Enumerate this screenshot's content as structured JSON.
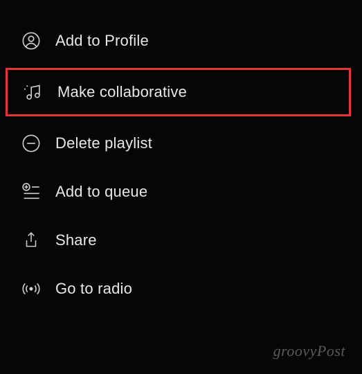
{
  "menu": {
    "items": [
      {
        "label": "Add to Profile",
        "icon": "profile-icon",
        "highlighted": false
      },
      {
        "label": "Make collaborative",
        "icon": "music-note-icon",
        "highlighted": true
      },
      {
        "label": "Delete playlist",
        "icon": "minus-circle-icon",
        "highlighted": false
      },
      {
        "label": "Add to queue",
        "icon": "add-queue-icon",
        "highlighted": false
      },
      {
        "label": "Share",
        "icon": "share-icon",
        "highlighted": false
      },
      {
        "label": "Go to radio",
        "icon": "radio-icon",
        "highlighted": false
      }
    ]
  },
  "watermark": "groovyPost"
}
